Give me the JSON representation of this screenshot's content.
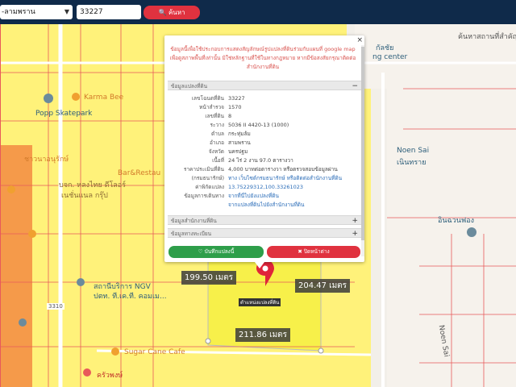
{
  "search": {
    "province_select": "-ลามพราน",
    "parcel_number": "33227",
    "search_label": "ค้นหา"
  },
  "map": {
    "pois": [
      {
        "label": "Karma Bee",
        "color": "orange"
      },
      {
        "label": "Popp Skatepark",
        "color": "dark"
      },
      {
        "label": "ชาวนาอนุรักษ์",
        "color": "orange"
      },
      {
        "label": "Bar&Restau",
        "color": "orange"
      },
      {
        "label": "บจก. หลงไทย ดีโลอร์",
        "color": "brown"
      },
      {
        "label": "เนชั่นแนล กรุ๊ป",
        "color": "brown"
      },
      {
        "label": "สถานีบริการ NGV",
        "color": "dark"
      },
      {
        "label": "ปตท. ที.เค.ที. คอมเม...",
        "color": "dark"
      },
      {
        "label": "Sugar Cane Cafe",
        "color": "orange"
      },
      {
        "label": "ครัวพงษ์",
        "color": "red"
      },
      {
        "label": "ค้นหาสถานที่สำคัญ",
        "color": "grey"
      },
      {
        "label": "Noen Sai",
        "color": "dark"
      },
      {
        "label": "เนินทราย",
        "color": "dark"
      },
      {
        "label": "อินฉวนฟอง",
        "color": "dark"
      },
      {
        "label": "ng center",
        "color": "dark"
      },
      {
        "label": "กัลชัย",
        "color": "dark"
      },
      {
        "label": "Noen Sai",
        "color": "grey"
      },
      {
        "label": "3310",
        "color": "grey"
      }
    ],
    "distances": [
      "199.50 เมตร",
      "204.47 เมตร",
      "211.86 เมตร"
    ],
    "parcel_label": "ตำแหน่งแปลงที่ดิน"
  },
  "popup": {
    "notice": "ข้อมูลนี้เพื่อใช้ประกอบการแสดงสัญลักษณ์รูปแปลงที่ดินร่วมกับแผนที่ google map เพื่อดูสภาพพื้นที่เท่านั้น มิใช่หลักฐานที่ใช้ในทางกฎหมาย หากมีข้อสงสัยกรุณาติดต่อสำนักงานที่ดิน",
    "section_parcel": "ข้อมูลแปลงที่ดิน",
    "section_parcel_symbol": "−",
    "rows": [
      {
        "key": "เลขโฉนดที่ดิน",
        "value": "33227"
      },
      {
        "key": "หน้าสำรวจ",
        "value": "1570"
      },
      {
        "key": "เลขที่ดิน",
        "value": "8"
      },
      {
        "key": "ระวาง",
        "value": "5036 II 4420-13 (1000)"
      },
      {
        "key": "ตำบล",
        "value": "กระทุ่มล้ม"
      },
      {
        "key": "อำเภอ",
        "value": "สามพราน"
      },
      {
        "key": "จังหวัด",
        "value": "นครปฐม"
      },
      {
        "key": "เนื้อที่",
        "value": "24 ไร่ 2 งาน 97.0 ตารางวา"
      },
      {
        "key": "ราคาประเมินที่ดิน",
        "value": "4,000 บาทต่อตารางวา หรือตรวจสอบข้อมูลผ่าน"
      },
      {
        "key": "(กรมธนารักษ์)",
        "value": "ทาง เว็บไซต์กรมธนารักษ์ หรือติดต่อสำนักงานที่ดิน"
      },
      {
        "key": "ค่าพิกัดแปลง",
        "value": "13.75229312,100.33261023"
      },
      {
        "key": "ข้อมูลการเดินทาง",
        "value": "จากที่นี่ไปยังแปลงที่ดิน"
      },
      {
        "key": "",
        "value": "จากแปลงที่ดินไปยังสำนักงานที่ดิน"
      }
    ],
    "section_office": "ข้อมูลสำนักงานที่ดิน",
    "section_office_symbol": "+",
    "section_registry": "ข้อมูลทางทะเบียน",
    "section_registry_symbol": "+",
    "save_label": "บันทึกแปลงนี้",
    "close_label": "ปิดหน้าต่าง",
    "close_x": "×"
  },
  "colors": {
    "topbar": "#0f2a4a",
    "search_button": "#e0323f",
    "zone_yellow": "#fff27a",
    "zone_orange": "#f59a4a",
    "parcel_fill": "#f7f04a",
    "save_button": "#2e9e4a",
    "close_button": "#e0323f",
    "marker": "#e0243a"
  }
}
